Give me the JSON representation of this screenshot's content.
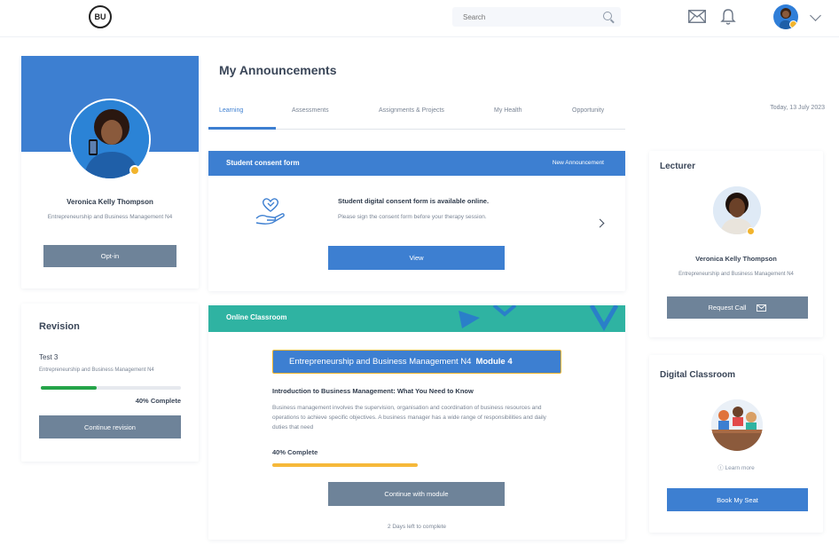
{
  "header": {
    "logo_text": "BU",
    "search_placeholder": "Search"
  },
  "profile": {
    "name": "Veronica Kelly Thompson",
    "course": "Entrepreneurship and Business Management N4",
    "optin_label": "Opt-in"
  },
  "revision": {
    "title": "Revision",
    "test": "Test 3",
    "course": "Entrepreneurship and Business Management N4",
    "progress": 0.4,
    "progress_label": "40% Complete",
    "button_label": "Continue revision"
  },
  "main": {
    "title": "My Announcements",
    "tabs": [
      {
        "label": "Learning"
      },
      {
        "label": "Assessments"
      },
      {
        "label": "Assignments & Projects"
      },
      {
        "label": "My Health"
      },
      {
        "label": "Opportunity"
      }
    ],
    "date": "Today, 13 July 2023"
  },
  "consent": {
    "title": "Student consent form",
    "badge": "New Announcement",
    "heading": "Student digital consent form is available online.",
    "text": "Please sign the consent form before your therapy session.",
    "button_label": "View"
  },
  "classroom": {
    "title": "Online Classroom",
    "course": "Entrepreneurship and Business Management N4",
    "module": "Module 4",
    "heading": "Introduction to Business Management: What You Need to Know",
    "text": "Business management involves the supervision, organisation and coordination of business resources and operations to achieve specific objectives. A business manager has a wide range of responsibilities and daily duties that need",
    "progress": 0.4,
    "progress_label": "40% Complete",
    "button_label": "Continue with module",
    "days_left": "2 Days left to complete"
  },
  "lecturer": {
    "title": "Lecturer",
    "name": "Veronica Kelly Thompson",
    "course": "Entrepreneurship and Business Management N4",
    "button_label": "Request Call"
  },
  "digital": {
    "title": "Digital Classroom",
    "learn_more": "Learn more",
    "button_label": "Book My Seat"
  },
  "colors": {
    "primary": "#3d7fd1",
    "muted_button": "#6e8399",
    "teal": "#2fb3a2",
    "accent_yellow": "#f2b42d",
    "success": "#25a449"
  }
}
